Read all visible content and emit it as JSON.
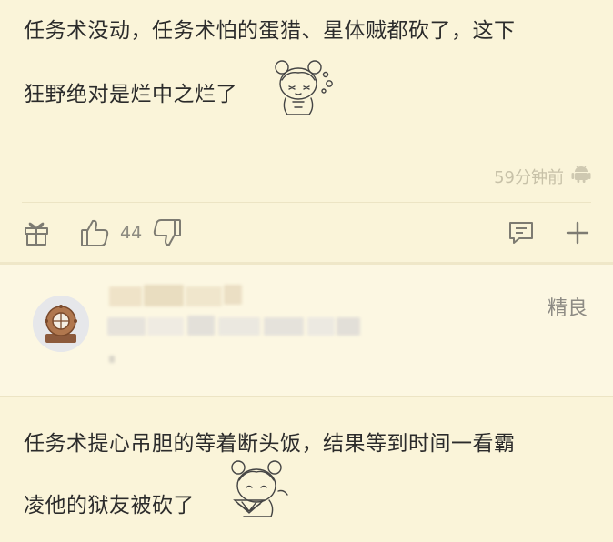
{
  "comment1": {
    "text_line1": "任务术没动，任务术怕的蛋猎、星体贼都砍了，这下",
    "text_line2": "狂野绝对是烂中之烂了",
    "sticker_icon": "anime-girl-sweat-sticker",
    "timestamp": "59分钟前",
    "device_icon": "android-icon"
  },
  "actions": {
    "gift_icon": "gift-icon",
    "like_icon": "thumbs-up-icon",
    "like_count": "44",
    "dislike_icon": "thumbs-down-icon",
    "reply_icon": "chat-bubble-icon",
    "more_icon": "plus-icon"
  },
  "reply": {
    "badge": "精良",
    "avatar_icon": "diving-helmet-avatar"
  },
  "comment2": {
    "text_line1": "任务术提心吊胆的等着断头饭，结果等到时间一看霸",
    "text_line2": "凌他的狱友被砍了",
    "sticker_icon": "anime-girl-fan-sticker"
  }
}
